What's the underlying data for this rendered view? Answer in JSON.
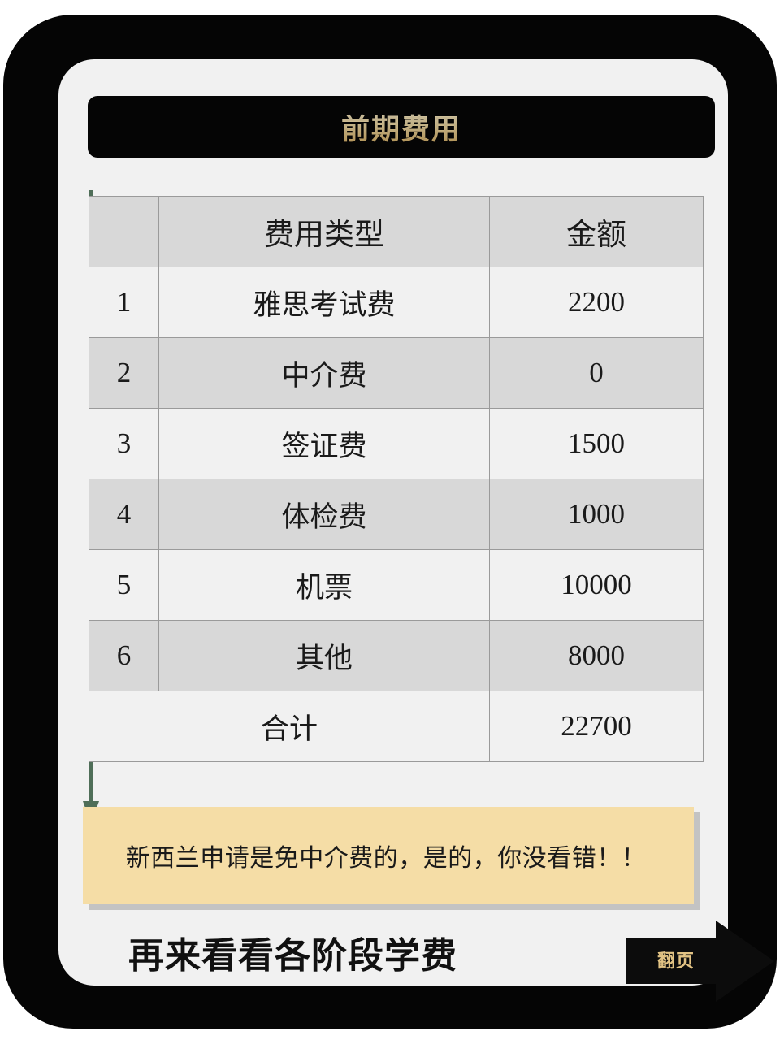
{
  "header": {
    "title": "前期费用"
  },
  "table": {
    "columns": [
      "",
      "费用类型",
      "金额"
    ],
    "rows": [
      {
        "no": "1",
        "type": "雅思考试费",
        "amount": "2200"
      },
      {
        "no": "2",
        "type": "中介费",
        "amount": "0"
      },
      {
        "no": "3",
        "type": "签证费",
        "amount": "1500"
      },
      {
        "no": "4",
        "type": "体检费",
        "amount": "1000"
      },
      {
        "no": "5",
        "type": "机票",
        "amount": "10000"
      },
      {
        "no": "6",
        "type": "其他",
        "amount": "8000"
      }
    ],
    "total": {
      "label": "合计",
      "amount": "22700"
    }
  },
  "note": {
    "text": "新西兰申请是免中介费的，是的，你没看错！！"
  },
  "footer": {
    "title": "再来看看各阶段学费",
    "next_label": "翻页"
  },
  "colors": {
    "frame": "#050505",
    "card": "#f1f1f1",
    "title_gold": "#f0dcab",
    "note_bg": "#f5dda6",
    "row_alt": "#d8d8d8",
    "row_base": "#f1f1f1",
    "flow_arrow": "#4f6e58"
  }
}
